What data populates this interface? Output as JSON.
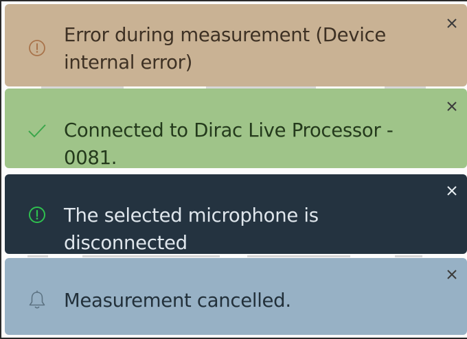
{
  "colors": {
    "error_bg": "#c9b294",
    "success_bg": "#9fc489",
    "dark_bg": "#243340",
    "info_bg": "#97b1c5",
    "success_accent": "#3aa64a",
    "dark_accent": "#2fc24f",
    "error_accent": "#a8734a"
  },
  "toasts": [
    {
      "kind": "error",
      "icon": "error-circle-icon",
      "message": "Error during measurement (Device internal error)",
      "close_icon": "close-icon"
    },
    {
      "kind": "success",
      "icon": "checkmark-icon",
      "message": "Connected to Dirac Live Processor - 0081.",
      "close_icon": "close-icon"
    },
    {
      "kind": "warning",
      "icon": "alert-circle-icon",
      "message": "The selected microphone is disconnected",
      "close_icon": "close-icon"
    },
    {
      "kind": "info",
      "icon": "bell-icon",
      "message": "Measurement cancelled.",
      "close_icon": "close-icon"
    }
  ]
}
